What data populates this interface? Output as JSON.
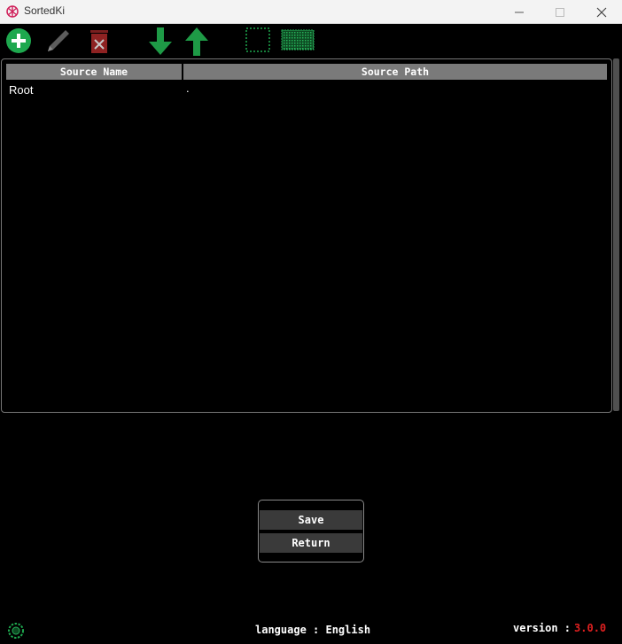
{
  "window": {
    "title": "SortedKi",
    "controls": [
      "minimize-icon",
      "maximize-icon",
      "close-icon"
    ]
  },
  "toolbar": {
    "icons": [
      "add-icon",
      "edit-pencil-icon",
      "delete-icon",
      "move-down-icon",
      "move-up-icon",
      "deselect-all-icon",
      "select-all-icon"
    ]
  },
  "table": {
    "columns": [
      "Source Name",
      "Source Path"
    ],
    "rows": [
      {
        "name": "Root",
        "path": "."
      }
    ]
  },
  "dialog": {
    "save_label": "Save",
    "return_label": "Return"
  },
  "footer": {
    "language_text": "language : English",
    "version_label": "version :",
    "version_number": "3.0.0"
  },
  "colors": {
    "background": "#000000",
    "accent_green": "#1ea84e",
    "version_red": "#e02020",
    "header_gray": "#7a7a7a"
  }
}
